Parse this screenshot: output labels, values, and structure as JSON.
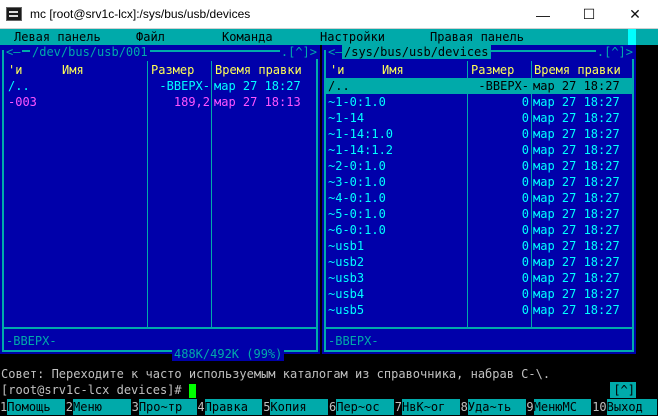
{
  "window": {
    "title": "mc [root@srv1c-lcx]:/sys/bus/usb/devices",
    "minimize": "—",
    "maximize": "☐",
    "close": "✕"
  },
  "menubar": {
    "items": [
      "Левая панель",
      "Файл",
      "Команда",
      "Настройки",
      "Правая панель"
    ]
  },
  "left_panel": {
    "path": "/dev/bus/usb/001",
    "corner": ".[^]>",
    "corner_left": "<–",
    "columns": {
      "sort": "'и",
      "name": "Имя",
      "size": "Размер",
      "mtime": "Время правки"
    },
    "rows": [
      {
        "name": "/..",
        "size": "-ВВЕРХ-",
        "mtime": "мар 27 18:27",
        "type": "norm"
      },
      {
        "name": "-003",
        "size": "189,2",
        "mtime": "мар 27 18:13",
        "type": "exe"
      }
    ],
    "mini_status": "-ВВЕРХ-",
    "space": "488K/492K (99%)"
  },
  "right_panel": {
    "path": "/sys/bus/usb/devices",
    "corner": ".[^]>",
    "corner_left": "<–",
    "columns": {
      "sort": "'и",
      "name": "Имя",
      "size": "Размер",
      "mtime": "Время правки"
    },
    "rows": [
      {
        "name": "/..",
        "size": "-ВВЕРХ-",
        "mtime": "мар 27 18:27",
        "type": "sel"
      },
      {
        "name": "~1-0:1.0",
        "size": "0",
        "mtime": "мар 27 18:27",
        "type": "norm"
      },
      {
        "name": "~1-14",
        "size": "0",
        "mtime": "мар 27 18:27",
        "type": "norm"
      },
      {
        "name": "~1-14:1.0",
        "size": "0",
        "mtime": "мар 27 18:27",
        "type": "norm"
      },
      {
        "name": "~1-14:1.2",
        "size": "0",
        "mtime": "мар 27 18:27",
        "type": "norm"
      },
      {
        "name": "~2-0:1.0",
        "size": "0",
        "mtime": "мар 27 18:27",
        "type": "norm"
      },
      {
        "name": "~3-0:1.0",
        "size": "0",
        "mtime": "мар 27 18:27",
        "type": "norm"
      },
      {
        "name": "~4-0:1.0",
        "size": "0",
        "mtime": "мар 27 18:27",
        "type": "norm"
      },
      {
        "name": "~5-0:1.0",
        "size": "0",
        "mtime": "мар 27 18:27",
        "type": "norm"
      },
      {
        "name": "~6-0:1.0",
        "size": "0",
        "mtime": "мар 27 18:27",
        "type": "norm"
      },
      {
        "name": "~usb1",
        "size": "0",
        "mtime": "мар 27 18:27",
        "type": "norm"
      },
      {
        "name": "~usb2",
        "size": "0",
        "mtime": "мар 27 18:27",
        "type": "norm"
      },
      {
        "name": "~usb3",
        "size": "0",
        "mtime": "мар 27 18:27",
        "type": "norm"
      },
      {
        "name": "~usb4",
        "size": "0",
        "mtime": "мар 27 18:27",
        "type": "norm"
      },
      {
        "name": "~usb5",
        "size": "0",
        "mtime": "мар 27 18:27",
        "type": "norm"
      }
    ],
    "mini_status": "-ВВЕРХ-"
  },
  "hint": "Совет: Переходите к часто используемым каталогам из справочника, набрав C-\\.",
  "command_line": {
    "prompt": "[root@srv1c-lcx devices]#",
    "caret_button": "[^]"
  },
  "fkeys": [
    {
      "n": "1",
      "label": "Помощь"
    },
    {
      "n": "2",
      "label": "Меню"
    },
    {
      "n": "3",
      "label": "Про~тр"
    },
    {
      "n": "4",
      "label": "Правка"
    },
    {
      "n": "5",
      "label": "Копия"
    },
    {
      "n": "6",
      "label": "Пер~ос"
    },
    {
      "n": "7",
      "label": "НвК~ог"
    },
    {
      "n": "8",
      "label": "Уда~ть"
    },
    {
      "n": "9",
      "label": "МенюMC"
    },
    {
      "n": "10",
      "label": "Выход"
    }
  ],
  "colors": {
    "panel_bg": "#0000aa",
    "cyan": "#00aaaa",
    "header_yellow": "#ffff55",
    "executable_magenta": "#ff55ff",
    "cursor_green": "#00ff00"
  }
}
